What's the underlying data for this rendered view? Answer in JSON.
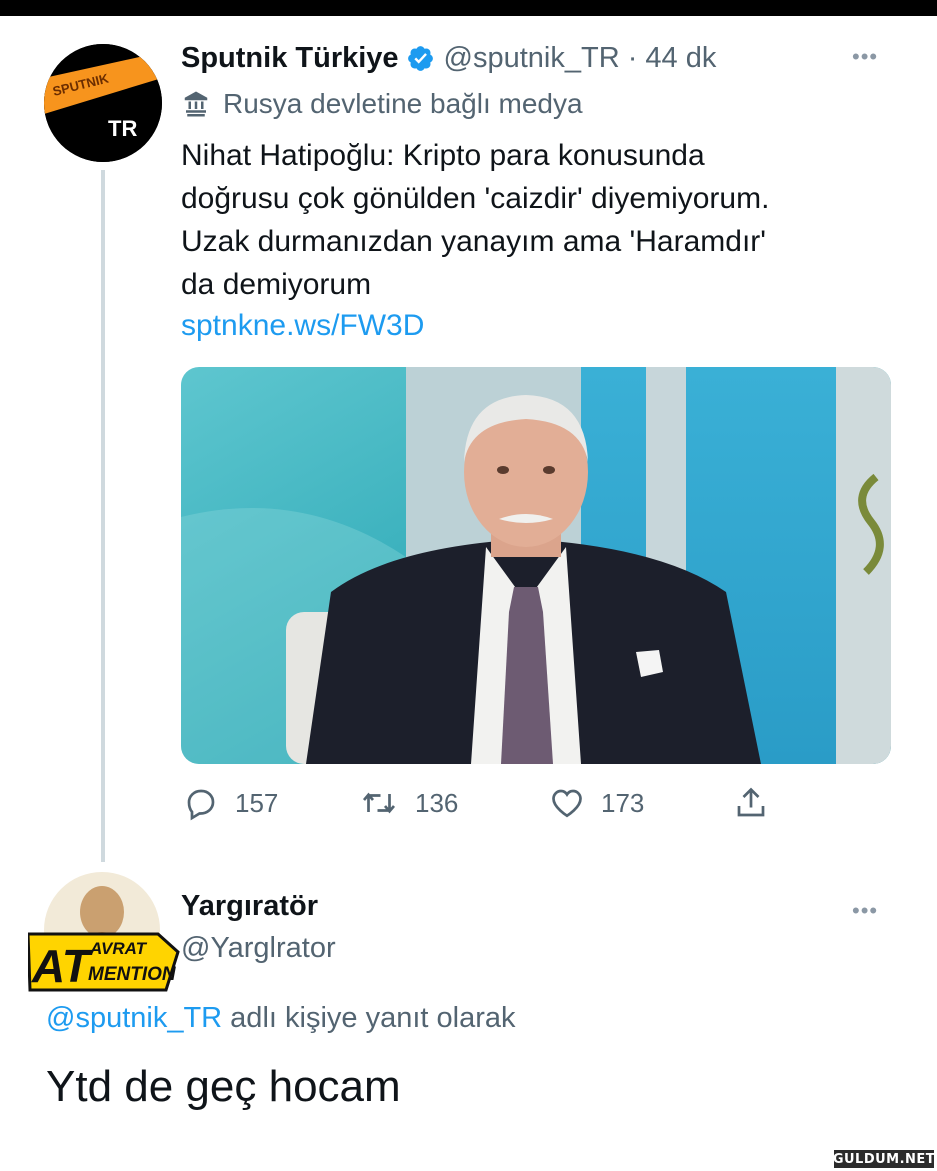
{
  "tweet": {
    "author_name": "Sputnik Türkiye",
    "handle_time": "@sputnik_TR · 44 dk",
    "more_label": "•••",
    "label": "Rusya devletine bağlı medya",
    "avatar_text_top": "SPUTNIK",
    "avatar_text_bottom": "TR",
    "text_lines": [
      "Nihat Hatipoğlu: Kripto para konusunda",
      "doğrusu çok gönülden 'caizdir' diyemiyorum.",
      "Uzak durmanızdan yanayım ama 'Haramdır'",
      "da demiyorum"
    ],
    "link": "sptnkne.ws/FW3D",
    "stats": {
      "replies": "157",
      "retweets": "136",
      "likes": "173"
    },
    "icons": [
      "verified-icon",
      "government-label-icon",
      "reply-icon",
      "retweet-icon",
      "like-icon",
      "share-icon"
    ]
  },
  "reply": {
    "author_name": "Yargıratör",
    "handle": "@Yarglrator",
    "more_label": "•••",
    "avatar_text_line1": "AVRAT",
    "avatar_text_line2": "MENTION",
    "avatar_text_big": "AT",
    "reply_to_mention": "@sputnik_TR",
    "reply_to_suffix": " adlı kişiye yanıt olarak",
    "text": "Ytd de geç hocam"
  },
  "watermark": "GULDUM.NET",
  "colors": {
    "link": "#1d9bf0",
    "secondary_text": "#536471",
    "primary_text": "#0f1419",
    "sputnik_orange": "#f7941d",
    "thread_line": "#cfd9de"
  }
}
